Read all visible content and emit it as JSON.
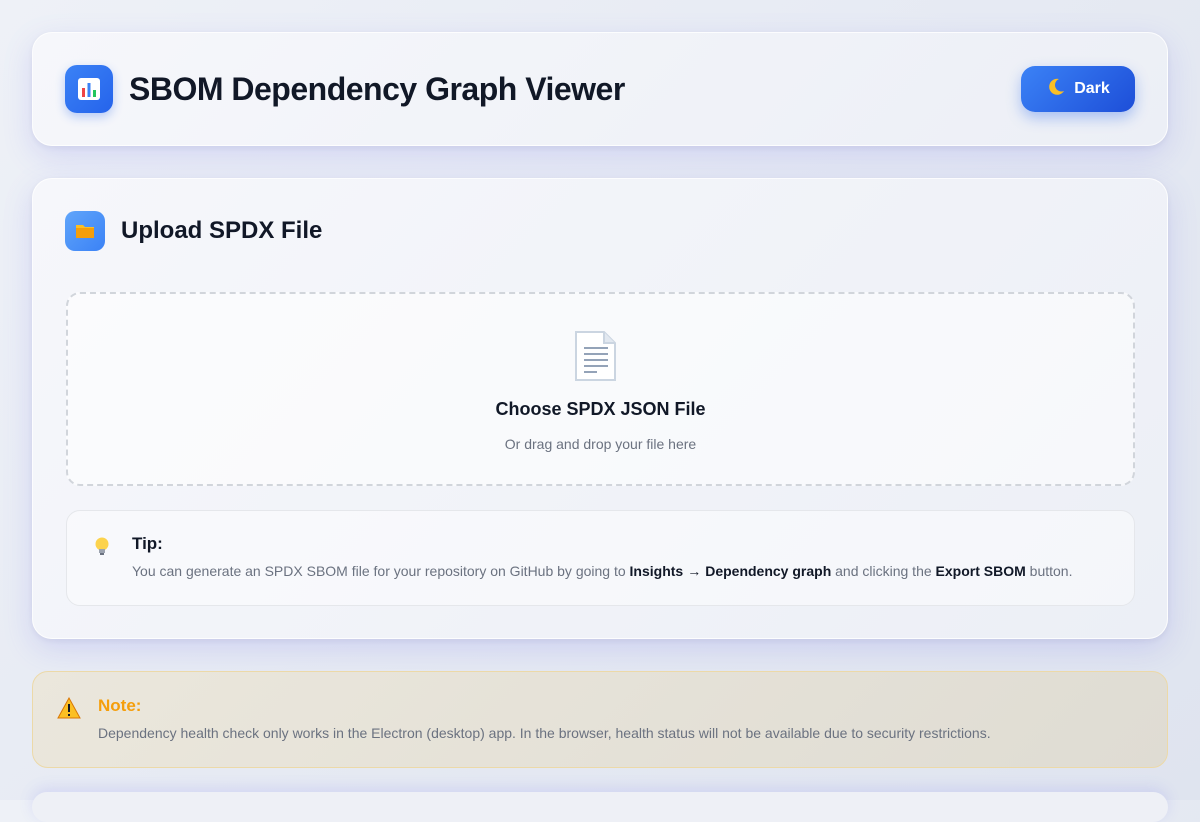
{
  "header": {
    "title": "SBOM Dependency Graph Viewer",
    "logo_icon": "bar-chart-icon",
    "theme_toggle": {
      "icon": "moon-icon",
      "label": "Dark"
    }
  },
  "upload": {
    "section_icon": "folder-icon",
    "section_title": "Upload SPDX File",
    "dropzone": {
      "icon": "document-icon",
      "title": "Choose SPDX JSON File",
      "subtitle": "Or drag and drop your file here"
    },
    "tip": {
      "icon": "lightbulb-icon",
      "title": "Tip:",
      "text_before": "You can generate an SPDX SBOM file for your repository on GitHub by going to",
      "bold_insights": "Insights",
      "arrow": "→",
      "bold_dependency_graph": "Dependency graph",
      "text_middle": "and clicking the",
      "bold_export": "Export SBOM",
      "text_after": "button."
    }
  },
  "note": {
    "icon": "warning-icon",
    "title": "Note:",
    "text": "Dependency health check only works in the Electron (desktop) app. In the browser, health status will not be available due to security restrictions."
  },
  "colors": {
    "accent": "#2563eb",
    "warning": "#f59e0b",
    "text_primary": "#111827",
    "text_muted": "#6b7280"
  }
}
